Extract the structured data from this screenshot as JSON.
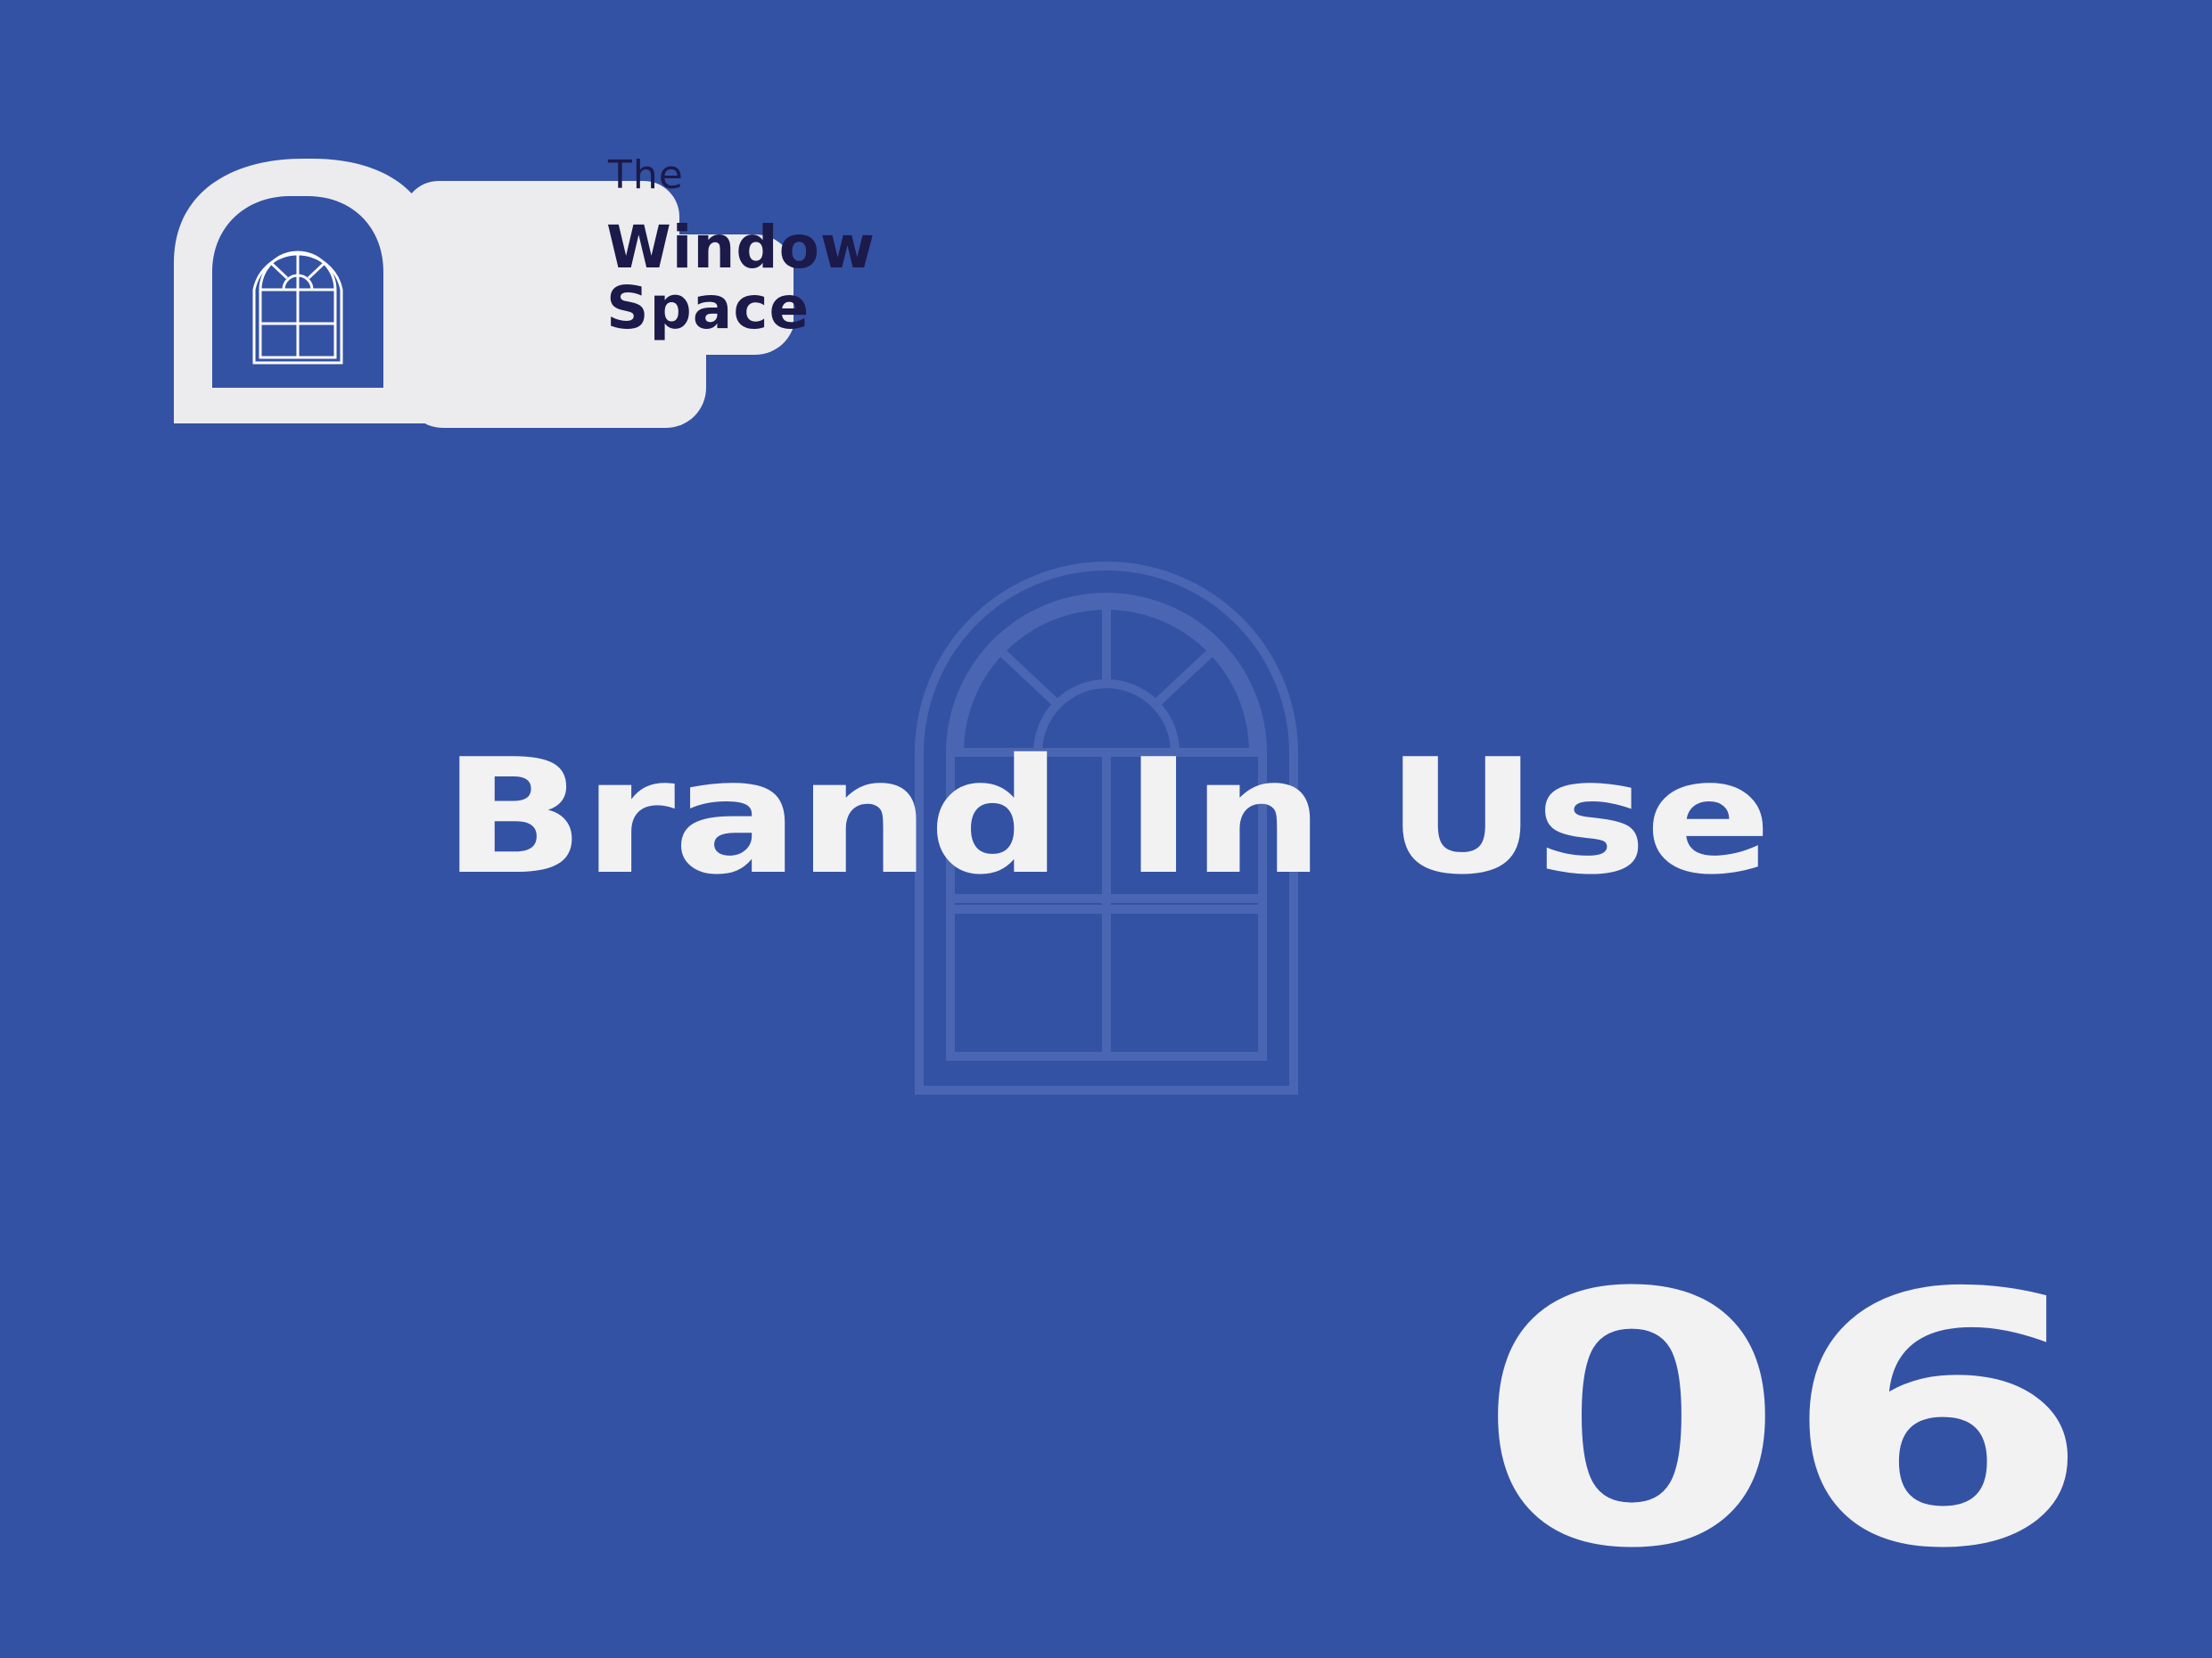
{
  "colors": {
    "background": "#3452a4",
    "text": "#f2f2f3",
    "logo_badge": "#ececee",
    "logo_text": "#1b1a4a"
  },
  "logo": {
    "line_the": "The",
    "line_window": "Window",
    "line_space": "Space",
    "icon": "arched-window-icon"
  },
  "headline": "Brand In Use",
  "page_number": "06",
  "background_graphic": "arched-window-icon"
}
